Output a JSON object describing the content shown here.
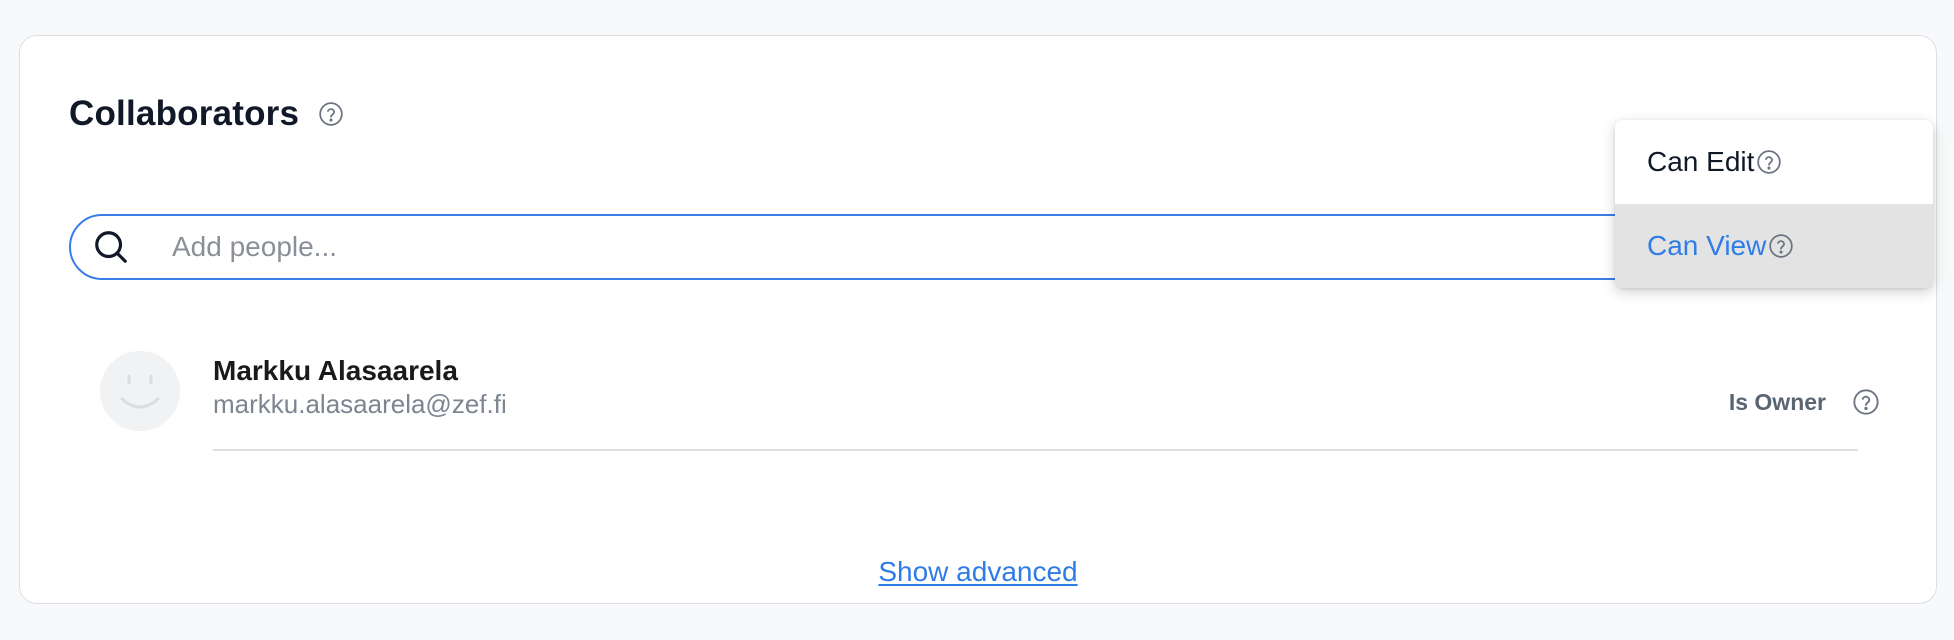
{
  "collaborators": {
    "title": "Collaborators",
    "help_icon": "question-circle-icon"
  },
  "search": {
    "icon": "search-icon",
    "placeholder": "Add people...",
    "value": ""
  },
  "people": [
    {
      "name": "Markku Alasaarela",
      "email": "markku.alasaarela@zef.fi",
      "role": "Is Owner",
      "avatar_icon": "smiley-avatar-icon"
    }
  ],
  "show_advanced_label": "Show advanced",
  "permission_menu": {
    "items": [
      {
        "label": "Can Edit",
        "selected": false
      },
      {
        "label": "Can View",
        "selected": true
      }
    ]
  },
  "colors": {
    "accent": "#2f7ce6",
    "search_border": "#3b7de8",
    "hover_bg": "#e3e3e3",
    "muted_text": "#7c8590"
  }
}
